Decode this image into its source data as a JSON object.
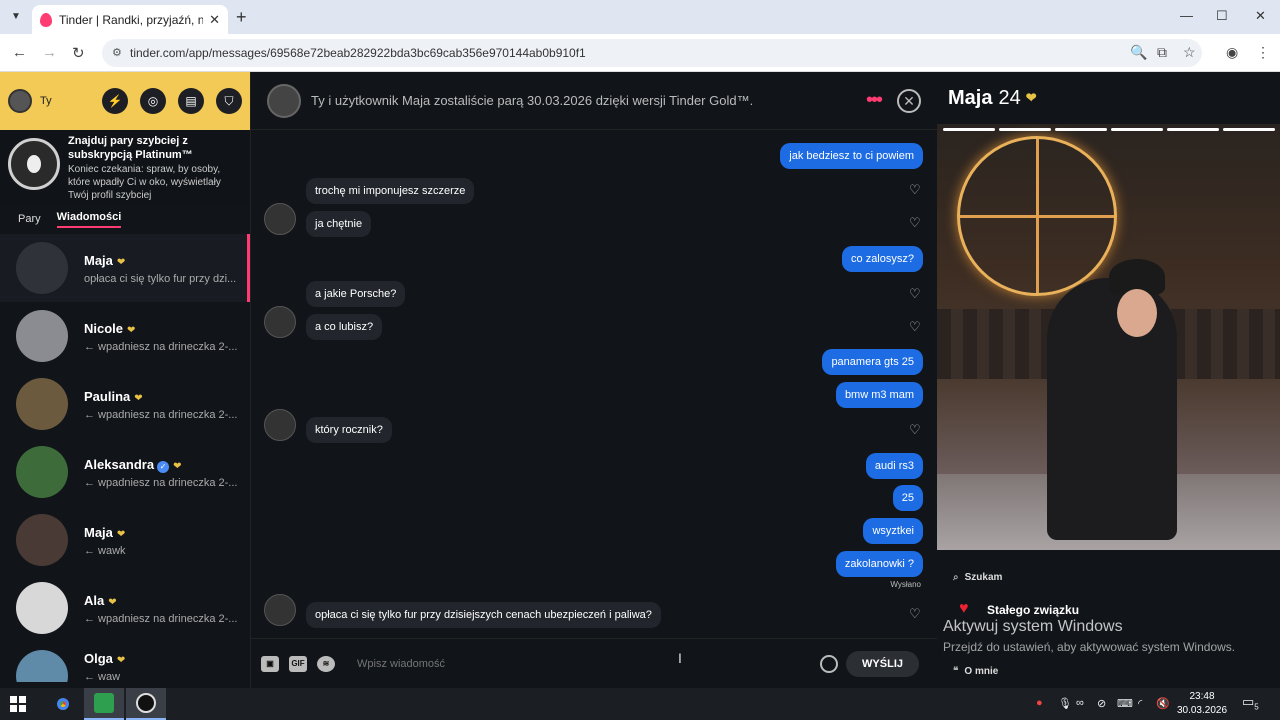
{
  "browser": {
    "tab_title": "Tinder | Randki, przyjaźń, nowe",
    "url": "tinder.com/app/messages/69568e72beab282922bda3bc69cab356e970144ab0b910f1"
  },
  "sidebar": {
    "user_label": "Ty",
    "promo_title": "Znajduj pary szybciej z subskrypcją Platinum™",
    "promo_desc": "Koniec czekania: spraw, by osoby, które wpadły Ci w oko, wyświetlały Twój profil szybciej",
    "tab_matches": "Pary",
    "tab_messages": "Wiadomości",
    "conversations": [
      {
        "name": "Maja",
        "preview": "opłaca ci się tylko fur przy dzi..."
      },
      {
        "name": "Nicole",
        "preview": "← wpadniesz na drineczka 2-..."
      },
      {
        "name": "Paulina",
        "preview": "← wpadniesz na drineczka 2-..."
      },
      {
        "name": "Aleksandra",
        "preview": "← wpadniesz na drineczka 2-..."
      },
      {
        "name": "Maja",
        "preview": "← wawk"
      },
      {
        "name": "Ala",
        "preview": "← wpadniesz na drineczka 2-..."
      },
      {
        "name": "Olga",
        "preview": "← waw"
      }
    ]
  },
  "chat": {
    "match_text": "Ty i użytkownik Maja zostaliście parą 30.03.2026 dzięki wersji Tinder Gold™.",
    "messages": [
      {
        "dir": "out",
        "text": "jak bedziesz to ci powiem"
      },
      {
        "dir": "in",
        "text": "trochę mi imponujesz szczerze"
      },
      {
        "dir": "in",
        "text": "ja chętnie"
      },
      {
        "dir": "out",
        "text": "co zalosysz?"
      },
      {
        "dir": "in",
        "text": "a jakie Porsche?"
      },
      {
        "dir": "in",
        "text": "a co lubisz?"
      },
      {
        "dir": "out",
        "text": "panamera gts 25"
      },
      {
        "dir": "out",
        "text": "bmw m3 mam"
      },
      {
        "dir": "in",
        "text": "który rocznik?"
      },
      {
        "dir": "out",
        "text": "audi rs3"
      },
      {
        "dir": "out",
        "text": "25"
      },
      {
        "dir": "out",
        "text": "wsyztkei"
      },
      {
        "dir": "out",
        "text": "zakolanowki ?"
      },
      {
        "dir": "in",
        "text": "opłaca ci się tylko fur przy dzisiejszych cenach ubezpieczeń i paliwa?"
      }
    ],
    "sent_label": "Wysłano",
    "input_placeholder": "Wpisz wiadomość",
    "send_label": "WYŚLIJ",
    "gif_label": "GIF"
  },
  "profile": {
    "name": "Maja",
    "age": "24",
    "looking_for_label": "Szukam",
    "looking_for_value": "Stałego związku",
    "about_label": "O mnie"
  },
  "windows_watermark": {
    "line1": "Aktywuj system Windows",
    "line2": "Przejdź do ustawień, aby aktywować system Windows."
  },
  "taskbar": {
    "time": "23:48",
    "date": "30.03.2026",
    "notif_count": "5"
  }
}
